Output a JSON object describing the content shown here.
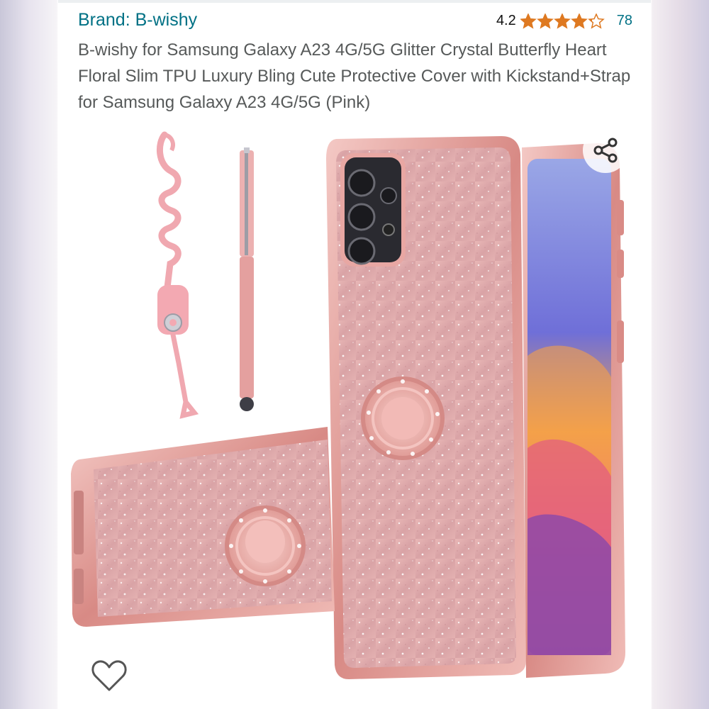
{
  "listing": {
    "brand_label": "Brand: B-wishy",
    "rating_value": "4.2",
    "rating_stars": 4.2,
    "review_count": "78",
    "title": "B-wishy for Samsung Galaxy A23 4G/5G Glitter Crystal Butterfly Heart Floral Slim TPU Luxury Bling Cute Protective Cover with Kickstand+Strap for Samsung Galaxy A23 4G/5G (Pink)"
  },
  "icons": {
    "star": "star-icon",
    "share": "share-icon",
    "heart": "heart-icon"
  },
  "colors": {
    "link": "#007185",
    "star": "#de7921",
    "title_text": "#565959",
    "case_pink": "#e7a9a6",
    "case_chrome": "#d98b86"
  }
}
